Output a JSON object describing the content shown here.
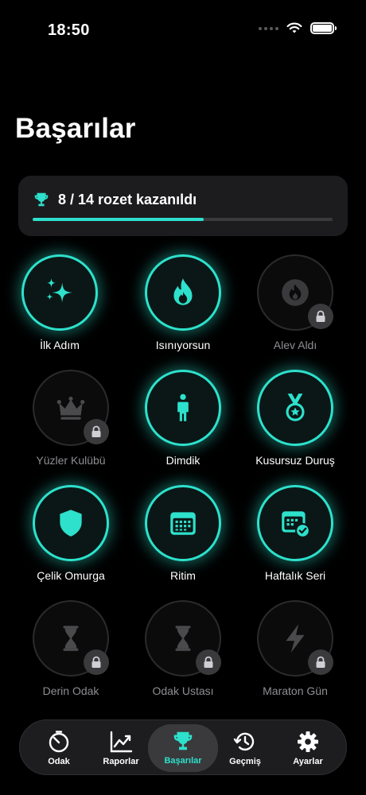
{
  "status_bar": {
    "time": "18:50"
  },
  "page_title": "Başarılar",
  "progress": {
    "text": "8 / 14 rozet kazanıldı",
    "earned": 8,
    "total": 14,
    "fraction": 0.571
  },
  "colors": {
    "accent": "#2de1cc",
    "card": "#1c1c1e",
    "locked": "#3a3a3c",
    "background": "#000000"
  },
  "badges": [
    {
      "label": "İlk Adım",
      "icon": "sparkles-icon",
      "earned": true
    },
    {
      "label": "Isınıyorsun",
      "icon": "flame-icon",
      "earned": true
    },
    {
      "label": "Alev Aldı",
      "icon": "flame-icon",
      "earned": false
    },
    {
      "label": "Yüzler Kulübü",
      "icon": "crown-icon",
      "earned": false
    },
    {
      "label": "Dimdik",
      "icon": "standing-person-icon",
      "earned": true
    },
    {
      "label": "Kusursuz Duruş",
      "icon": "medal-icon",
      "earned": true
    },
    {
      "label": "Çelik Omurga",
      "icon": "shield-icon",
      "earned": true
    },
    {
      "label": "Ritim",
      "icon": "calendar-icon",
      "earned": true
    },
    {
      "label": "Haftalık Seri",
      "icon": "calendar-check-icon",
      "earned": true
    },
    {
      "label": "Derin Odak",
      "icon": "hourglass-icon",
      "earned": false
    },
    {
      "label": "Odak Ustası",
      "icon": "hourglass-icon",
      "earned": false
    },
    {
      "label": "Maraton Gün",
      "icon": "bolt-icon",
      "earned": false
    }
  ],
  "tab_bar": {
    "tabs": [
      {
        "label": "Odak",
        "icon": "timer-icon",
        "active": false
      },
      {
        "label": "Raporlar",
        "icon": "chart-line-icon",
        "active": false
      },
      {
        "label": "Başarılar",
        "icon": "trophy-icon",
        "active": true
      },
      {
        "label": "Geçmiş",
        "icon": "history-icon",
        "active": false
      },
      {
        "label": "Ayarlar",
        "icon": "gear-icon",
        "active": false
      }
    ]
  }
}
